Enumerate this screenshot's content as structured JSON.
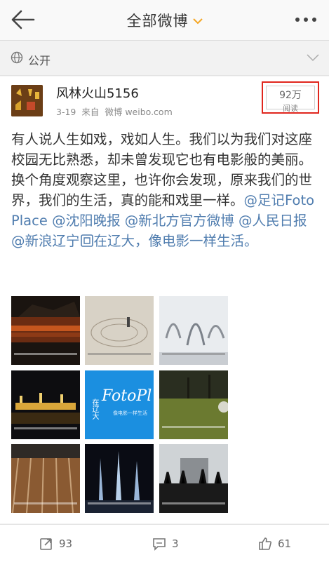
{
  "header": {
    "title": "全部微博"
  },
  "scope": {
    "label": "公开"
  },
  "post": {
    "username": "风林火山5156",
    "date": "3-19",
    "source_prefix": "来自",
    "source": "微博 weibo.com",
    "read_count": "92万",
    "read_label": "阅读",
    "text_main": "有人说人生如戏，戏如人生。我们以为我们对这座校园无比熟悉，却未曾发现它也有电影般的美丽。换个角度观察这里，也许你会发现，原来我们的世界，我们的生活，真的能和戏里一样。",
    "mentions": [
      "@足记FotoPlace",
      "@沈阳晚报",
      "@新北方官方微博",
      "@人民日报",
      "@新浪辽宁"
    ],
    "location": "在辽大，像电影一样生活。"
  },
  "image_text": {
    "fotoplace_logo": "FotoPl",
    "fotoplace_side": "在辽大",
    "fotoplace_sub": "像电影一样生活"
  },
  "actions": {
    "repost_count": "93",
    "comment_count": "3",
    "like_count": "61"
  },
  "colors": {
    "link": "#507daf",
    "highlight": "#e0261d",
    "accent": "#f5a623"
  }
}
